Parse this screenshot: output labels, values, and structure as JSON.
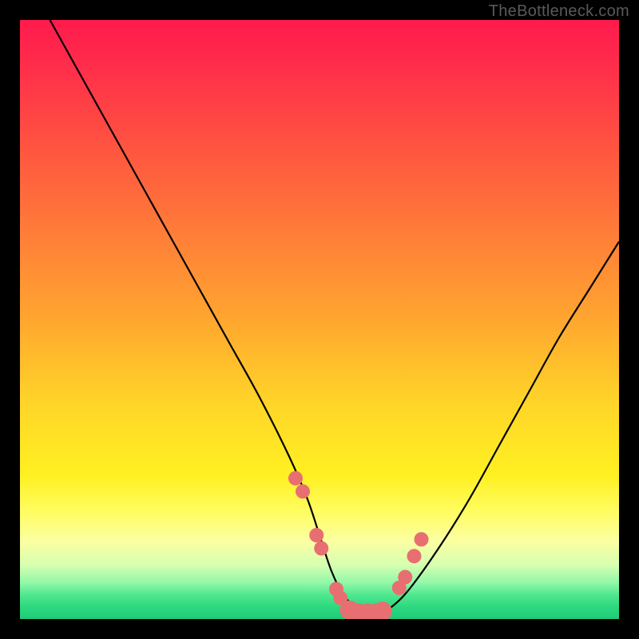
{
  "watermark": "TheBottleneck.com",
  "chart_data": {
    "type": "line",
    "title": "",
    "xlabel": "",
    "ylabel": "",
    "xlim": [
      0,
      100
    ],
    "ylim": [
      0,
      100
    ],
    "series": [
      {
        "name": "curve",
        "x": [
          5,
          10,
          15,
          20,
          25,
          30,
          35,
          40,
          45,
          48,
          50,
          52,
          54,
          56,
          58,
          60,
          62,
          65,
          70,
          75,
          80,
          85,
          90,
          95,
          100
        ],
        "values": [
          100,
          91,
          82,
          73,
          64,
          55,
          46,
          37,
          27,
          20,
          14,
          8,
          4,
          2,
          1,
          1,
          2,
          5,
          12,
          20,
          29,
          38,
          47,
          55,
          63
        ]
      }
    ],
    "markers": [
      {
        "x": 46.0,
        "y": 23.5,
        "r": 1.2
      },
      {
        "x": 47.2,
        "y": 21.3,
        "r": 1.2
      },
      {
        "x": 49.5,
        "y": 14.0,
        "r": 1.2
      },
      {
        "x": 50.3,
        "y": 11.8,
        "r": 1.2
      },
      {
        "x": 52.8,
        "y": 5.0,
        "r": 1.2
      },
      {
        "x": 53.5,
        "y": 3.5,
        "r": 1.2
      },
      {
        "x": 55.0,
        "y": 1.5,
        "r": 1.6
      },
      {
        "x": 56.5,
        "y": 1.0,
        "r": 1.6
      },
      {
        "x": 58.0,
        "y": 1.0,
        "r": 1.6
      },
      {
        "x": 59.5,
        "y": 1.0,
        "r": 1.6
      },
      {
        "x": 60.5,
        "y": 1.3,
        "r": 1.6
      },
      {
        "x": 63.3,
        "y": 5.2,
        "r": 1.2
      },
      {
        "x": 64.3,
        "y": 7.0,
        "r": 1.2
      },
      {
        "x": 65.8,
        "y": 10.5,
        "r": 1.2
      },
      {
        "x": 67.0,
        "y": 13.3,
        "r": 1.2
      }
    ],
    "colors": {
      "curve_stroke": "#000000",
      "marker_fill": "#e86f71"
    }
  }
}
